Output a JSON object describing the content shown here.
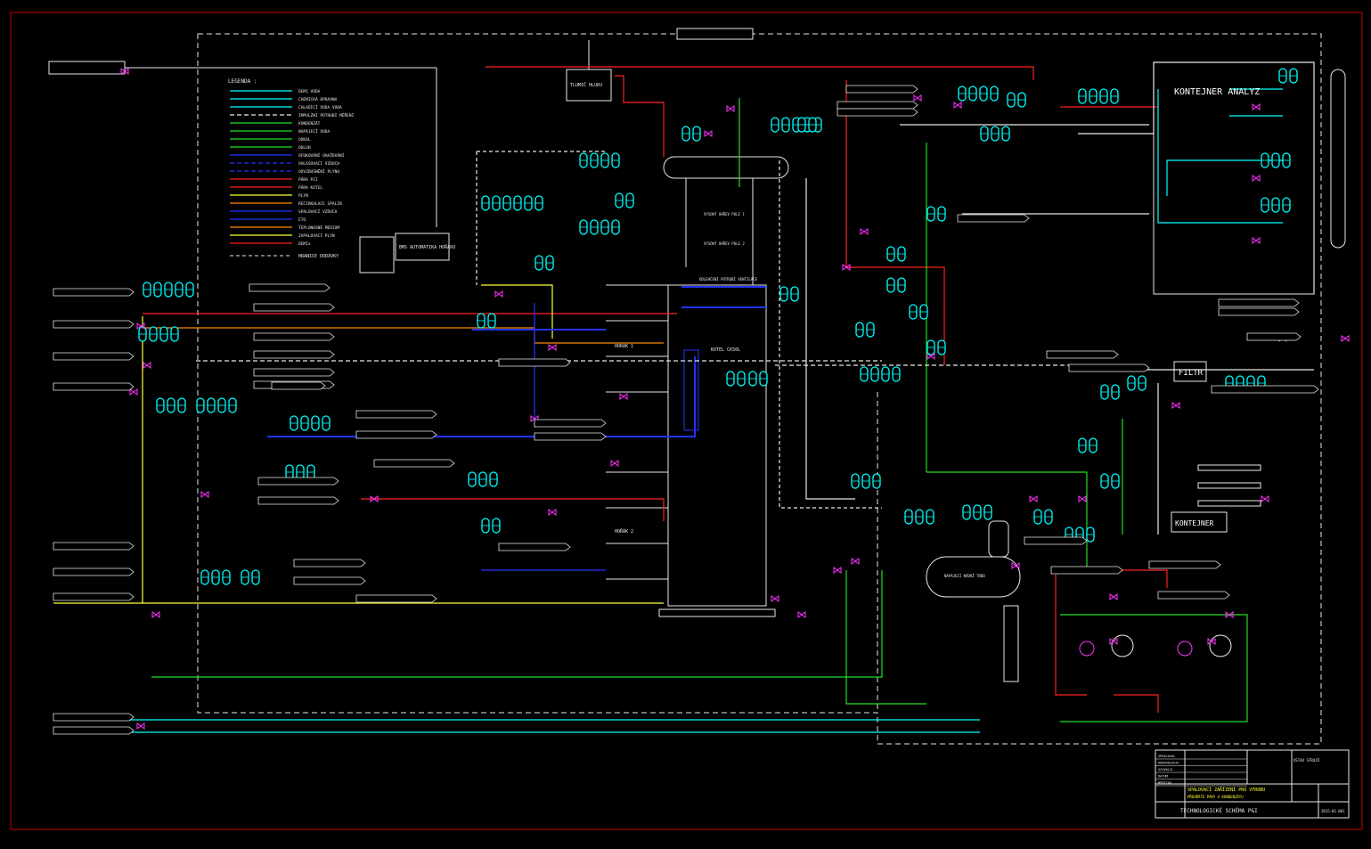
{
  "colors": {
    "background": "#000000",
    "frame": "#cc0000",
    "cyan": "#00ffff",
    "magenta": "#ff33ff",
    "red": "#ff2020",
    "green": "#22dd22",
    "yellow": "#ffff33",
    "blue": "#2233ff",
    "orange": "#ff8800",
    "white": "#e8e8e8"
  },
  "legend": {
    "title": "LEGENDA :",
    "items": [
      {
        "label": "DEMI VODA",
        "color": "#00ffff"
      },
      {
        "label": "CHEMICKÁ ÚPRAVNA",
        "color": "#00ffff"
      },
      {
        "label": "CHLADÍCÍ VODA VODA",
        "color": "#00ffff"
      },
      {
        "label": "IMPULZNÍ POTRUBÍ MĚŘENÍ",
        "color": "#e8e8e8"
      },
      {
        "label": "KONDENZÁT",
        "color": "#22dd22"
      },
      {
        "label": "NAPÁJECÍ VODA",
        "color": "#22dd22"
      },
      {
        "label": "ODKAL",
        "color": "#22dd22"
      },
      {
        "label": "ODLUH",
        "color": "#22dd22"
      },
      {
        "label": "OFUKOVÁNÍ OHAŽOVÁNÍ",
        "color": "#2233ff"
      },
      {
        "label": "OHLAŠOVACÍ VZDUCH",
        "color": "#2233ff"
      },
      {
        "label": "ODVZDUŠNĚNÍ PLYNU",
        "color": "#2233ff"
      },
      {
        "label": "PÁRA PII",
        "color": "#ff2020"
      },
      {
        "label": "PÁRA KOTEL",
        "color": "#ff2020"
      },
      {
        "label": "PLYN",
        "color": "#ffff33"
      },
      {
        "label": "RECIRKULACE SPALIN",
        "color": "#ff8800"
      },
      {
        "label": "SPALOVACÍ VZDUCH",
        "color": "#2233ff"
      },
      {
        "label": "ETO",
        "color": "#2233ff"
      },
      {
        "label": "TEPLONOSNÉ MEDIUM",
        "color": "#ff8800"
      },
      {
        "label": "ZAPALOVACÍ PLYN",
        "color": "#ffff33"
      },
      {
        "label": "DEMIx",
        "color": "#ff2020"
      }
    ]
  },
  "legend_extra": "HRANICE DODÁVKY",
  "labels": {
    "kontejner_analyz": "KONTEJNER ANALYZ",
    "kontejner": "KONTEJNER",
    "filtr": "FILTR",
    "tlumic": "TLUMIČ HLUKU",
    "bms": "BMS AUTOMATIKA HOŘÁKU",
    "horak1": "HOŘÁK 1",
    "horak2": "HOŘÁK 2",
    "kotel": "KOTEL CK50L",
    "napajeci_nadrz": "NAPÁJECÍ NÁDRŽ TRBÚ",
    "vysoky_ohrev": "VYSOKÝ OHŘEV POLE 1",
    "vysoky_ohrev2": "VYSOKÝ OHŘEV POLE 2",
    "odlehceni": "ODLEHČENÍ POTRUBÍ VENTILACE"
  },
  "title_block": {
    "project_title": "SPALOVACÍ ZAŘÍZENÍ PRO VÝROBU",
    "project_sub": "PŘEHŘÁTÉ PÁRY A KONDENZÁTU",
    "drawing_title": "TECHNOLOGICKÉ SCHÉMA P&I",
    "company": "ÚSTAV STROJŮ",
    "rows": [
      "ZPRACOVAL",
      "KONTROLOVAL",
      "SCHVÁLIL",
      "DATUM",
      "MĚŘÍTKO",
      "FORMÁT",
      "ČÍSLO VÝKRESU",
      "REVIZE"
    ],
    "number": "2015-01-001"
  }
}
